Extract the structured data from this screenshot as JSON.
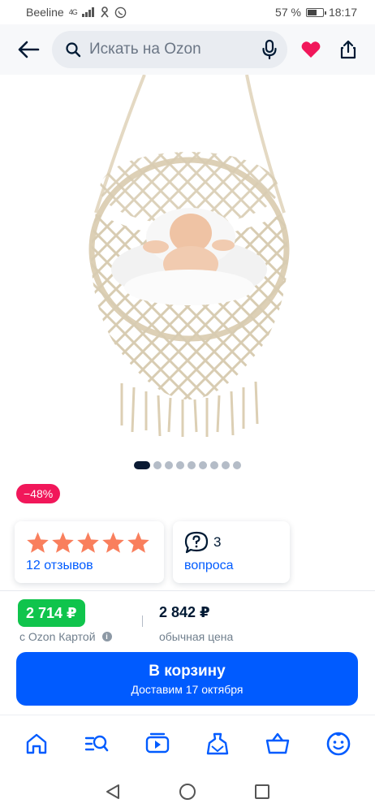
{
  "status_bar": {
    "carrier": "Beeline",
    "signal": "4G",
    "battery": "57 %",
    "time": "18:17"
  },
  "header": {
    "search_placeholder": "Искать на Ozon"
  },
  "gallery": {
    "image_count": 9,
    "active_index": 0
  },
  "badge": {
    "discount": "−48%"
  },
  "reviews_card": {
    "rating": 5,
    "reviews_label": "12 отзывов"
  },
  "questions_card": {
    "count": "3",
    "label": "вопроса"
  },
  "price": {
    "ozon_price": "2 714 ₽",
    "ozon_label": "с Ozon Картой",
    "regular_price": "2 842 ₽",
    "regular_label": "обычная цена"
  },
  "cart": {
    "button_label": "В корзину",
    "delivery": "Доставим 17 октября"
  },
  "colors": {
    "brand_blue": "#005bff",
    "discount_pink": "#f1175a",
    "ozon_green": "#10c44c",
    "star": "#f97f5d",
    "favorite_red": "#f1175a"
  },
  "nav_icons": [
    "home-icon",
    "catalog-search-icon",
    "video-icon",
    "fresh-icon",
    "cart-basket-icon",
    "profile-icon"
  ]
}
